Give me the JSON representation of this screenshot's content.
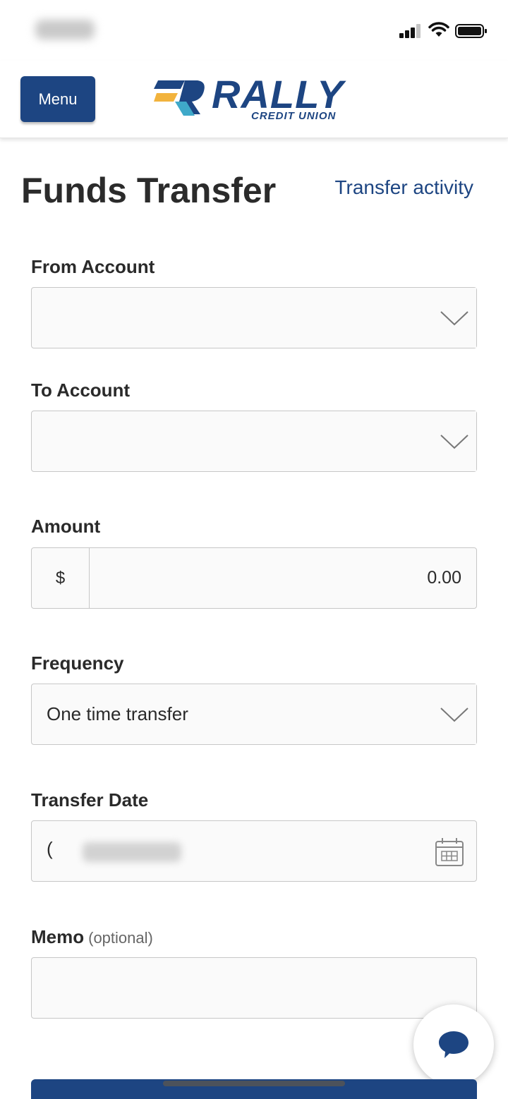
{
  "header": {
    "menu_label": "Menu",
    "logo_word": "RALLY",
    "logo_sub": "CREDIT UNION"
  },
  "page": {
    "title": "Funds Transfer",
    "activity_link": "Transfer activity"
  },
  "form": {
    "from_account": {
      "label": "From Account",
      "value": ""
    },
    "to_account": {
      "label": "To Account",
      "value": ""
    },
    "amount": {
      "label": "Amount",
      "prefix": "$",
      "value": "0.00"
    },
    "frequency": {
      "label": "Frequency",
      "value": "One time transfer"
    },
    "transfer_date": {
      "label": "Transfer Date",
      "value_prefix": "("
    },
    "memo": {
      "label": "Memo",
      "optional": "(optional)",
      "value": ""
    }
  },
  "colors": {
    "brand_navy": "#1d4582",
    "logo_accent_yellow": "#f2b33d",
    "logo_accent_teal": "#3fa9c9"
  },
  "icons": {
    "chat": "chat-bubble-icon",
    "calendar": "calendar-icon",
    "dropdown": "chevron-down-icon"
  }
}
